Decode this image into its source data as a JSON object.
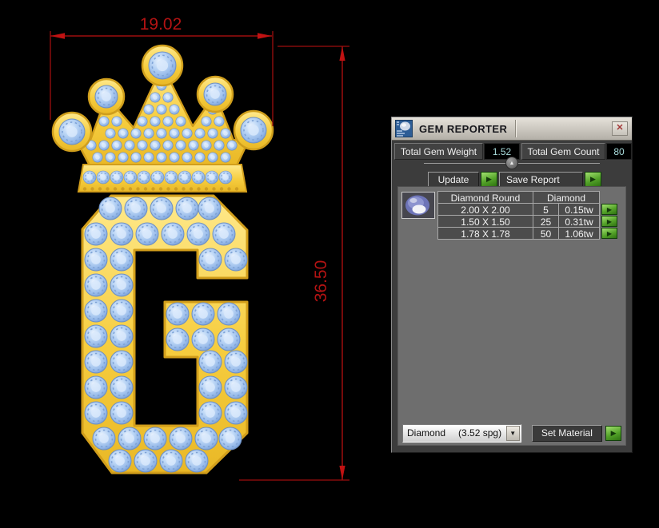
{
  "window": {
    "title": "GEM REPORTER",
    "icons": {
      "close": "✕",
      "collapse": "▲",
      "dropdown": "▼",
      "run": "▶"
    },
    "totals": [
      {
        "label": "Total Gem Weight",
        "value": "1.52"
      },
      {
        "label": "Total Gem Count",
        "value": "80"
      }
    ],
    "actions": {
      "update": "Update",
      "save_report": "Save Report",
      "set_material": "Set Material"
    },
    "gem_table": {
      "columns": [
        "Diamond Round",
        "Diamond"
      ],
      "rows": [
        {
          "size": "2.00 X 2.00",
          "count": "5",
          "weight": "0.15tw"
        },
        {
          "size": "1.50 X 1.50",
          "count": "25",
          "weight": "0.31tw"
        },
        {
          "size": "1.78 X 1.78",
          "count": "50",
          "weight": "1.06tw"
        }
      ]
    },
    "material": {
      "name": "Diamond",
      "density": "(3.52 spg)"
    }
  },
  "annotations": {
    "width": "19.02",
    "height": "36.50"
  },
  "colors": {
    "dimension_line": "#9e0e0e",
    "dimension_arrow": "#c01212",
    "dimension_text": "#b31313",
    "gold": "#f5cb3e",
    "gold_edge": "#d29e1b",
    "gem_blue": "#a9c9f0",
    "accent_green": "#54a329"
  }
}
